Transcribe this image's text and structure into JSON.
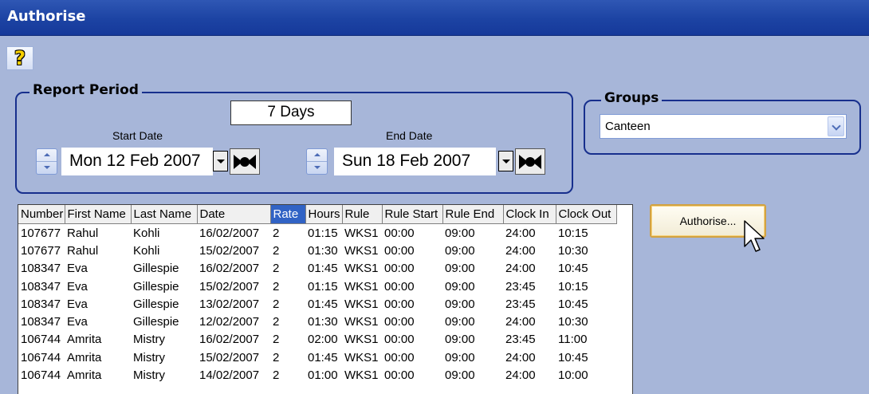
{
  "window": {
    "title": "Authorise"
  },
  "toolbar": {
    "help_icon": "help-icon",
    "help_glyph": "?"
  },
  "report_period": {
    "title": "Report Period",
    "days": "7 Days",
    "start_label": "Start Date",
    "start_value": "Mon 12 Feb 2007",
    "end_label": "End Date",
    "end_value": "Sun 18 Feb 2007"
  },
  "groups": {
    "title": "Groups",
    "selected": "Canteen"
  },
  "grid": {
    "columns": [
      "Number",
      "First Name",
      "Last Name",
      "Date",
      "Rate",
      "Hours",
      "Rule",
      "Rule Start",
      "Rule End",
      "Clock In",
      "Clock Out"
    ],
    "selected_column": "Rate",
    "rows": [
      [
        "107677",
        "Rahul",
        "Kohli",
        "16/02/2007",
        "2",
        "01:15",
        "WKS1",
        "00:00",
        "09:00",
        "24:00",
        "10:15"
      ],
      [
        "107677",
        "Rahul",
        "Kohli",
        "15/02/2007",
        "2",
        "01:30",
        "WKS1",
        "00:00",
        "09:00",
        "24:00",
        "10:30"
      ],
      [
        "108347",
        "Eva",
        "Gillespie",
        "16/02/2007",
        "2",
        "01:45",
        "WKS1",
        "00:00",
        "09:00",
        "24:00",
        "10:45"
      ],
      [
        "108347",
        "Eva",
        "Gillespie",
        "15/02/2007",
        "2",
        "01:15",
        "WKS1",
        "00:00",
        "09:00",
        "23:45",
        "10:15"
      ],
      [
        "108347",
        "Eva",
        "Gillespie",
        "13/02/2007",
        "2",
        "01:45",
        "WKS1",
        "00:00",
        "09:00",
        "23:45",
        "10:45"
      ],
      [
        "108347",
        "Eva",
        "Gillespie",
        "12/02/2007",
        "2",
        "01:30",
        "WKS1",
        "00:00",
        "09:00",
        "24:00",
        "10:30"
      ],
      [
        "106744",
        "Amrita",
        "Mistry",
        "16/02/2007",
        "2",
        "02:00",
        "WKS1",
        "00:00",
        "09:00",
        "23:45",
        "11:00"
      ],
      [
        "106744",
        "Amrita",
        "Mistry",
        "15/02/2007",
        "2",
        "01:45",
        "WKS1",
        "00:00",
        "09:00",
        "24:00",
        "10:45"
      ],
      [
        "106744",
        "Amrita",
        "Mistry",
        "14/02/2007",
        "2",
        "01:00",
        "WKS1",
        "00:00",
        "09:00",
        "24:00",
        "10:00"
      ]
    ]
  },
  "actions": {
    "authorise_label": "Authorise..."
  },
  "colors": {
    "title_bar": "#1f47a6",
    "background": "#a7b6d9",
    "group_border": "#172f8d",
    "selected_header": "#3163c5",
    "button_border": "#d2a242"
  }
}
